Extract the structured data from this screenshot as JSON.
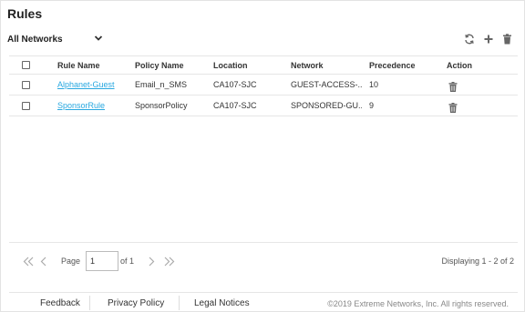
{
  "page": {
    "title": "Rules"
  },
  "filter": {
    "selected": "All Networks"
  },
  "toolbar": {
    "icons": [
      "refresh-icon",
      "add-icon",
      "delete-icon"
    ]
  },
  "table": {
    "columns": [
      "Rule Name",
      "Policy Name",
      "Location",
      "Network",
      "Precedence",
      "Action"
    ],
    "rows": [
      {
        "rule": "Alphanet-Guest",
        "policy": "Email_n_SMS",
        "location": "CA107-SJC",
        "network": "GUEST-ACCESS-...",
        "precedence": "10"
      },
      {
        "rule": "SponsorRule",
        "policy": "SponsorPolicy",
        "location": "CA107-SJC",
        "network": "SPONSORED-GU...",
        "precedence": "9"
      }
    ]
  },
  "pager": {
    "page_label": "Page",
    "page_value": "1",
    "of_label": "of 1",
    "display": "Displaying 1 - 2 of 2"
  },
  "footer": {
    "feedback": "Feedback",
    "privacy": "Privacy Policy",
    "legal": "Legal Notices",
    "copyright": "©2019 Extreme Networks, Inc. All rights reserved."
  },
  "colors": {
    "link": "#29a8e0",
    "icon": "#666666"
  }
}
